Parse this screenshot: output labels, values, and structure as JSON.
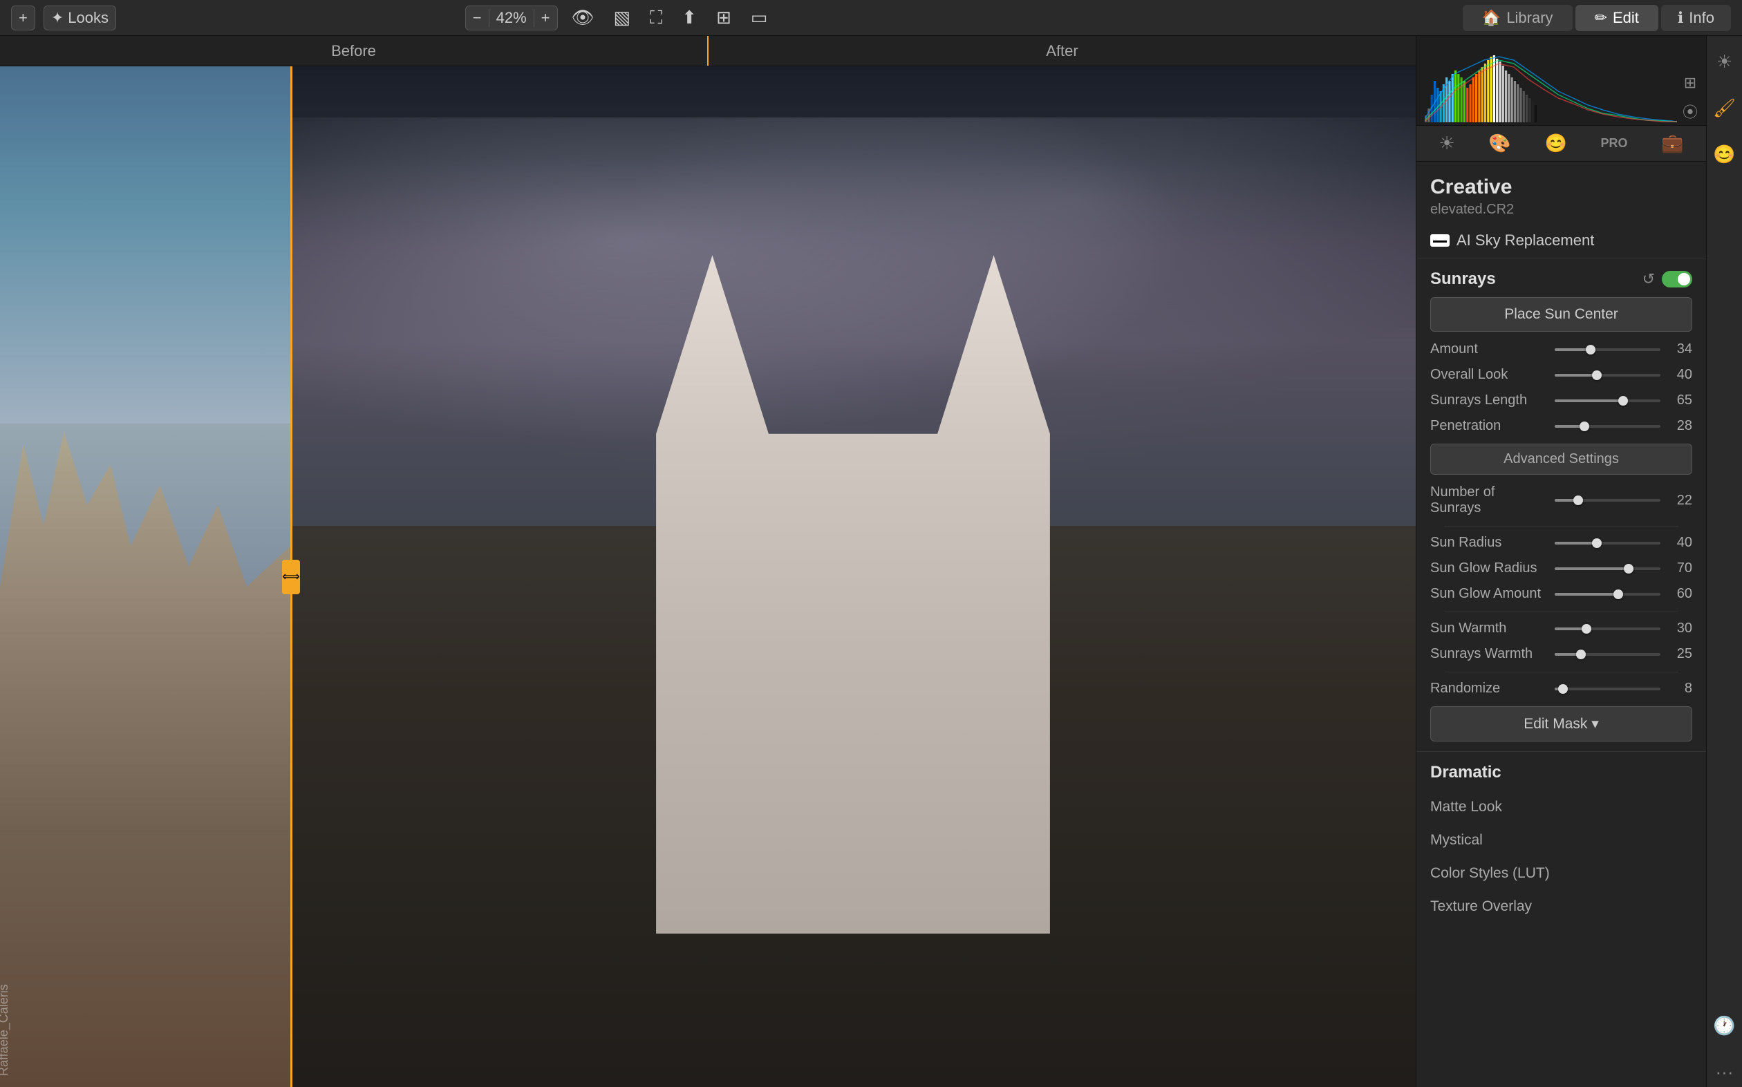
{
  "toolbar": {
    "add_icon": "+",
    "looks_label": "Looks",
    "zoom_value": "42%",
    "zoom_minus": "−",
    "zoom_plus": "+",
    "preview_icon": "👁",
    "compare_icon": "⬛",
    "crop_icon": "⬜",
    "share_icon": "↑",
    "grid_icon": "⊞",
    "window_icon": "▭",
    "library_label": "Library",
    "edit_label": "Edit",
    "info_label": "Info"
  },
  "canvas": {
    "before_label": "Before",
    "after_label": "After",
    "watermark": "Raffaele_Caleris"
  },
  "panel": {
    "creative_title": "Creative",
    "filename": "elevated.CR2",
    "ai_sky_label": "AI Sky Replacement",
    "sections": {
      "sunrays": {
        "title": "Sunrays",
        "place_sun_btn": "Place Sun Center",
        "advanced_btn": "Advanced Settings",
        "edit_mask_btn": "Edit Mask ▾",
        "sliders": [
          {
            "label": "Amount",
            "value": 34,
            "percent": 34
          },
          {
            "label": "Overall Look",
            "value": 40,
            "percent": 40
          },
          {
            "label": "Sunrays Length",
            "value": 65,
            "percent": 65
          },
          {
            "label": "Penetration",
            "value": 28,
            "percent": 28
          },
          {
            "label": "Number of Sunrays",
            "value": 22,
            "percent": 22
          },
          {
            "label": "Sun Radius",
            "value": 40,
            "percent": 40
          },
          {
            "label": "Sun Glow Radius",
            "value": 70,
            "percent": 70
          },
          {
            "label": "Sun Glow Amount",
            "value": 60,
            "percent": 60
          },
          {
            "label": "Sun Warmth",
            "value": 30,
            "percent": 30
          },
          {
            "label": "Sunrays Warmth",
            "value": 25,
            "percent": 25
          },
          {
            "label": "Randomize",
            "value": 8,
            "percent": 8
          }
        ]
      },
      "dramatic": {
        "title": "Dramatic"
      },
      "lower_items": [
        "Matte Look",
        "Mystical",
        "Color Styles (LUT)",
        "Texture Overlay"
      ]
    }
  }
}
